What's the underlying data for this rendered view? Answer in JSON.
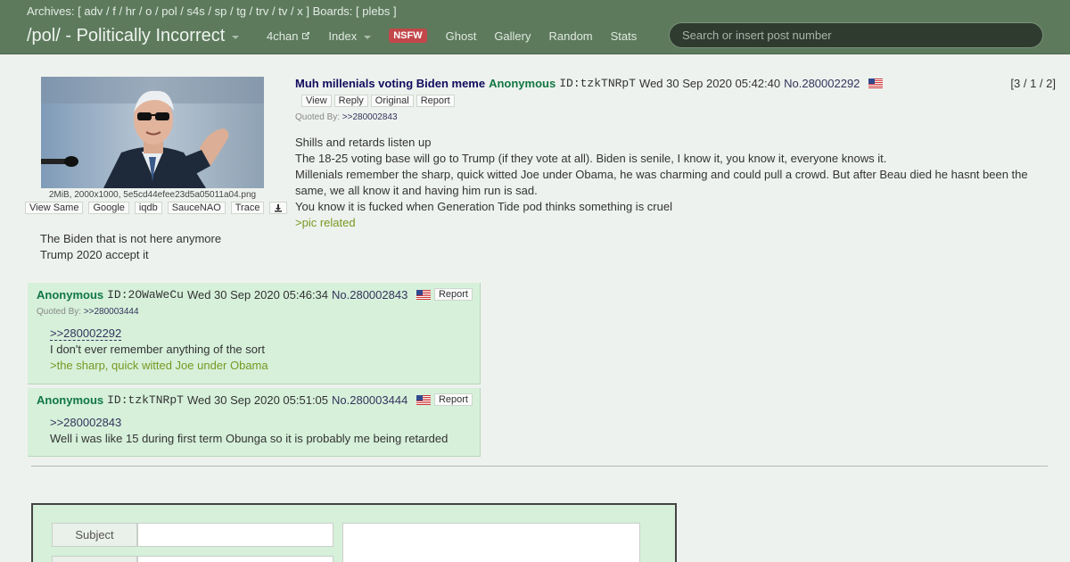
{
  "topbar": {
    "archives_label": "Archives:",
    "archives": [
      "adv",
      "f",
      "hr",
      "o",
      "pol",
      "s4s",
      "sp",
      "tg",
      "trv",
      "tv",
      "x"
    ],
    "boards_label": "Boards:",
    "boards": [
      "plebs"
    ],
    "board_title": "/pol/ - Politically Incorrect",
    "nav": {
      "fourchan": "4chan",
      "index": "Index",
      "nsfw": "NSFW",
      "ghost": "Ghost",
      "gallery": "Gallery",
      "random": "Random",
      "stats": "Stats"
    },
    "search_placeholder": "Search or insert post number"
  },
  "op": {
    "file_info": "2MiB, 2000x1000, 5e5cd44efee23d5a05011a04.png",
    "image_tools": [
      "View Same",
      "Google",
      "iqdb",
      "SauceNAO",
      "Trace"
    ],
    "side_text": [
      "The Biden that is not here anymore",
      "Trump 2020 accept it"
    ],
    "subject": "Muh millenials voting Biden meme",
    "name": "Anonymous",
    "id": "ID:tzkTNRpT",
    "date": "Wed 30 Sep 2020 05:42:40",
    "post_no": "No.280002292",
    "counter": "[3 / 1 / 2]",
    "buttons": [
      "View",
      "Reply",
      "Original",
      "Report"
    ],
    "quoted_by_label": "Quoted By:",
    "quoted_by": ">>280002843",
    "body": [
      "Shills and retards listen up",
      "The 18-25 voting base will go to Trump (if they vote at all). Biden is senile, I know it, you know it, everyone knows it.",
      "Millenials remember the sharp, quick witted Joe under Obama, he was charming and could pull a crowd. But after Beau died he hasnt been the same, we all know it and having him run is sad.",
      "You know it is fucked when Generation Tide pod thinks something is cruel"
    ],
    "greentext": ">pic related"
  },
  "replies": [
    {
      "name": "Anonymous",
      "id": "ID:2OWaWeCu",
      "date": "Wed 30 Sep 2020 05:46:34",
      "post_no": "No.280002843",
      "report": "Report",
      "quoted_by_label": "Quoted By:",
      "quoted_by": ">>280003444",
      "quote_link": ">>280002292",
      "text": "I don't ever remember anything of the sort",
      "greentext": ">the sharp, quick witted Joe under Obama"
    },
    {
      "name": "Anonymous",
      "id": "ID:tzkTNRpT",
      "date": "Wed 30 Sep 2020 05:51:05",
      "post_no": "No.280003444",
      "report": "Report",
      "quote_link": ">>280002843",
      "text": "Well i was like 15 during first term Obunga so it is probably me being retarded"
    }
  ],
  "form": {
    "subject_label": "Subject"
  },
  "colors": {
    "topbar": "#5d7a5d",
    "reply_bg": "#d6f0da",
    "name": "#117743",
    "subject": "#0f0c5d",
    "greentext": "#789922",
    "nsfw": "#c2474a"
  }
}
